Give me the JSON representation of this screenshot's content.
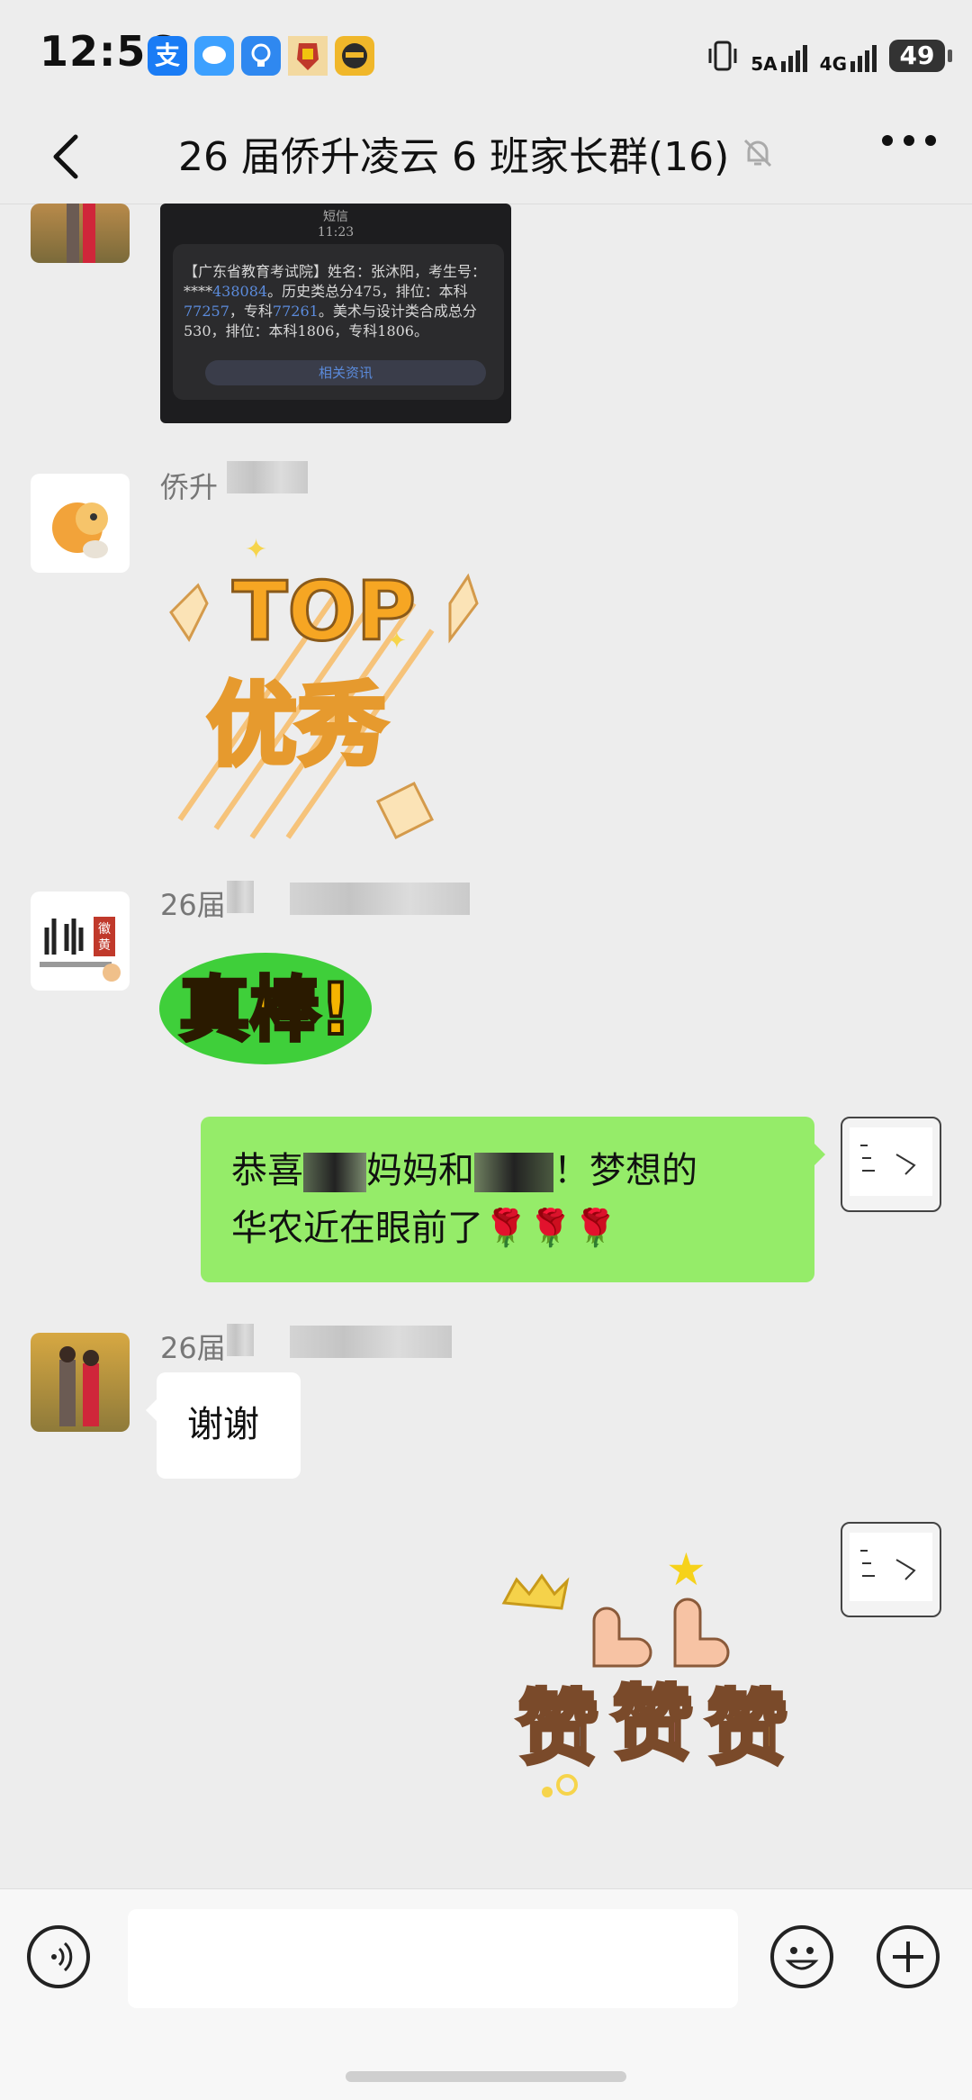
{
  "status_bar": {
    "time": "12:56",
    "net1": "5A",
    "net2": "4G",
    "battery": "49",
    "app_icons": [
      "alipay-icon",
      "message-icon",
      "bulb-icon",
      "ironman-icon",
      "mask-icon"
    ]
  },
  "header": {
    "title": "26 届侨升凌云 6 班家长群(16)",
    "back_icon": "back-arrow-icon",
    "mute_icon": "bell-muted-icon",
    "more_icon": "more-dots-icon"
  },
  "messages": {
    "sms": {
      "app": "短信",
      "time": "11:23",
      "text_prefix": "【广东省教育考试院】姓名：张沐阳，考生号：****",
      "exam_no": "438084",
      "text_mid1": "。历史类总分475，排位：本科",
      "rank1": "77257",
      "text_mid2": "，专科",
      "rank2": "77261",
      "text_end": "。美术与设计类合成总分530，排位：本科1806，专科1806。",
      "button": "相关资讯"
    },
    "msg2": {
      "sender": "侨升",
      "sticker_text": [
        "TOP",
        "优秀"
      ]
    },
    "msg3": {
      "sender": "26届",
      "sticker_text": "真棒!"
    },
    "msg4": {
      "line1_a": "恭喜",
      "line1_b": "妈妈和",
      "line1_c": "！梦想的",
      "line2": "华农近在眼前了",
      "emoji": "🌹🌹🌹"
    },
    "msg5": {
      "sender": "26届",
      "text": "谢谢"
    },
    "msg6": {
      "sticker_text": [
        "赞",
        "赞",
        "赞"
      ]
    }
  },
  "input_bar": {
    "voice_icon": "voice-icon",
    "emoji_icon": "emoji-icon",
    "plus_icon": "plus-icon",
    "input_value": ""
  }
}
